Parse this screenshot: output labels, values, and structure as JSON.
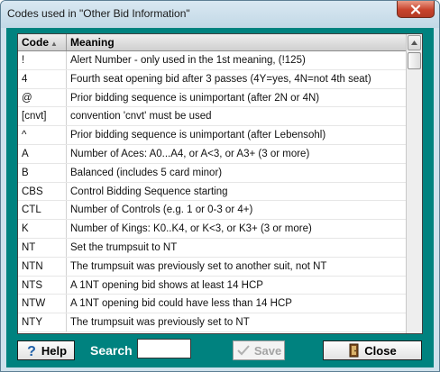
{
  "window": {
    "title": "Codes used in \"Other Bid Information\""
  },
  "table": {
    "columns": [
      {
        "label": "Code"
      },
      {
        "label": "Meaning"
      }
    ],
    "rows": [
      {
        "code": "!",
        "meaning": "Alert Number - only used in the 1st meaning,  (!125)"
      },
      {
        "code": "4",
        "meaning": "Fourth seat opening bid after 3 passes (4Y=yes, 4N=not 4th seat)"
      },
      {
        "code": "@",
        "meaning": "Prior bidding sequence is unimportant  (after 2N or 4N)"
      },
      {
        "code": "[cnvt]",
        "meaning": "convention 'cnvt' must be used"
      },
      {
        "code": "^",
        "meaning": "Prior bidding sequence is unimportant  (after Lebensohl)"
      },
      {
        "code": "A",
        "meaning": "Number of Aces: A0...A4, or A<3, or A3+ (3 or more)"
      },
      {
        "code": "B",
        "meaning": "Balanced (includes 5 card minor)"
      },
      {
        "code": "CBS",
        "meaning": "Control Bidding Sequence starting"
      },
      {
        "code": "CTL",
        "meaning": "Number of Controls (e.g. 1 or 0-3 or 4+)"
      },
      {
        "code": "K",
        "meaning": "Number of Kings: K0..K4, or K<3, or K3+ (3 or more)"
      },
      {
        "code": "NT",
        "meaning": "Set the trumpsuit to NT"
      },
      {
        "code": "NTN",
        "meaning": "The trumpsuit was previously set to another suit, not NT"
      },
      {
        "code": "NTS",
        "meaning": "A 1NT opening bid shows at least 14 HCP"
      },
      {
        "code": "NTW",
        "meaning": "A 1NT opening bid could have less than 14 HCP"
      },
      {
        "code": "NTY",
        "meaning": "The trumpsuit was previously set to NT"
      }
    ]
  },
  "toolbar": {
    "help_label": "Help",
    "search_label": "Search",
    "search_value": "",
    "save_label": "Save",
    "close_label": "Close"
  },
  "colors": {
    "client_background": "#00827f",
    "titlebar": "#cfe1ec",
    "close_button": "#c8432c"
  },
  "icons": {
    "close_window": "close-x-icon",
    "help": "question-mark-icon",
    "save": "checkmark-icon",
    "close": "door-exit-icon",
    "sort": "sort-ascending-icon",
    "scroll_up": "chevron-up-icon"
  }
}
